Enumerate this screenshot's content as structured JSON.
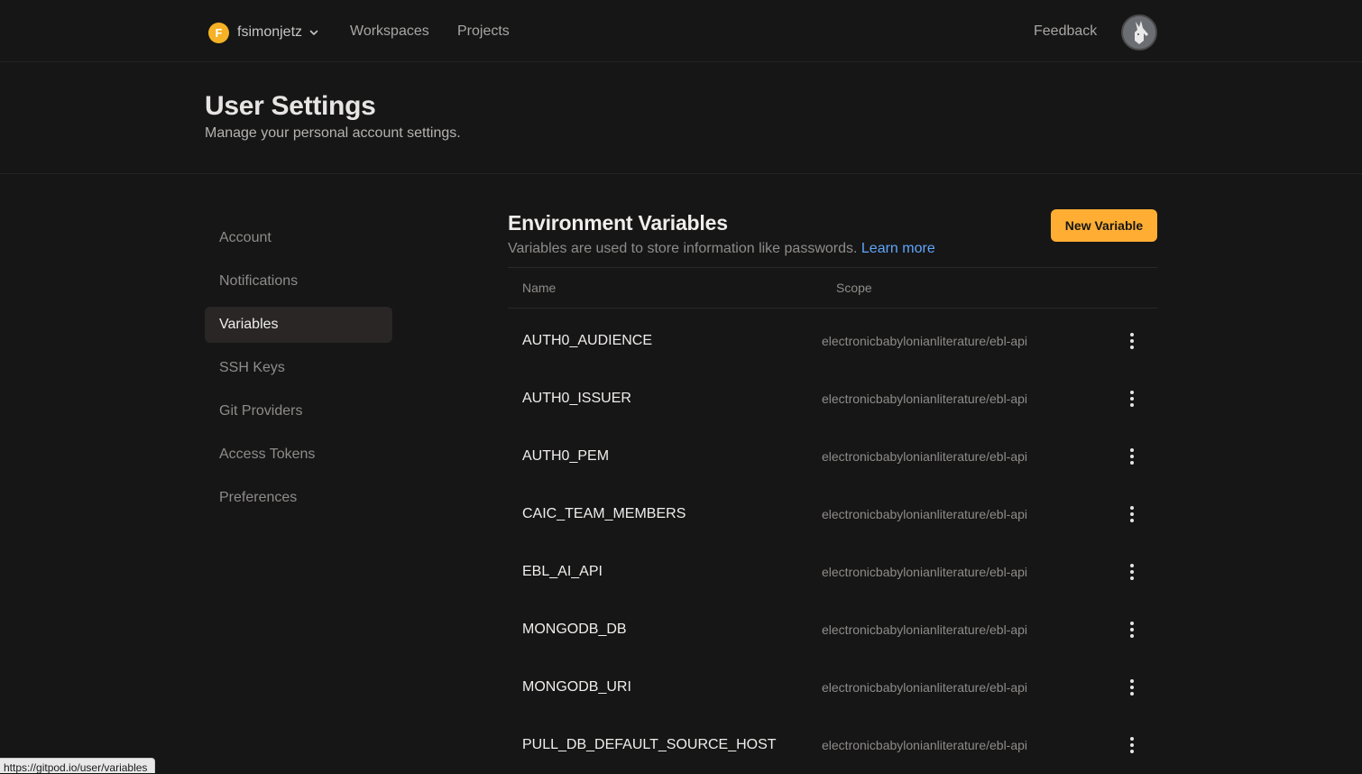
{
  "nav": {
    "org_initial": "F",
    "org_name": "fsimonjetz",
    "links": [
      "Workspaces",
      "Projects"
    ],
    "feedback": "Feedback"
  },
  "header": {
    "title": "User Settings",
    "subtitle": "Manage your personal account settings."
  },
  "sidebar": {
    "items": [
      "Account",
      "Notifications",
      "Variables",
      "SSH Keys",
      "Git Providers",
      "Access Tokens",
      "Preferences"
    ],
    "active": "Variables"
  },
  "main": {
    "title": "Environment Variables",
    "subtitle": "Variables are used to store information like passwords.",
    "learn_more": "Learn more",
    "new_button": "New Variable",
    "columns": [
      "Name",
      "Scope"
    ],
    "rows": [
      {
        "name": "AUTH0_AUDIENCE",
        "scope": "electronicbabylonianliterature/ebl-api"
      },
      {
        "name": "AUTH0_ISSUER",
        "scope": "electronicbabylonianliterature/ebl-api"
      },
      {
        "name": "AUTH0_PEM",
        "scope": "electronicbabylonianliterature/ebl-api"
      },
      {
        "name": "CAIC_TEAM_MEMBERS",
        "scope": "electronicbabylonianliterature/ebl-api"
      },
      {
        "name": "EBL_AI_API",
        "scope": "electronicbabylonianliterature/ebl-api"
      },
      {
        "name": "MONGODB_DB",
        "scope": "electronicbabylonianliterature/ebl-api"
      },
      {
        "name": "MONGODB_URI",
        "scope": "electronicbabylonianliterature/ebl-api"
      },
      {
        "name": "PULL_DB_DEFAULT_SOURCE_HOST",
        "scope": "electronicbabylonianliterature/ebl-api"
      }
    ]
  },
  "status_url": "https://gitpod.io/user/variables",
  "colors": {
    "background": "#161616",
    "accent_button": "#ffae33",
    "link": "#60a5fa",
    "org_avatar": "#f5b225"
  },
  "icons": {
    "org_dropdown": "chevron-down-icon",
    "row_menu": "more-vertical-icon",
    "user_avatar": "user-avatar-icon"
  }
}
